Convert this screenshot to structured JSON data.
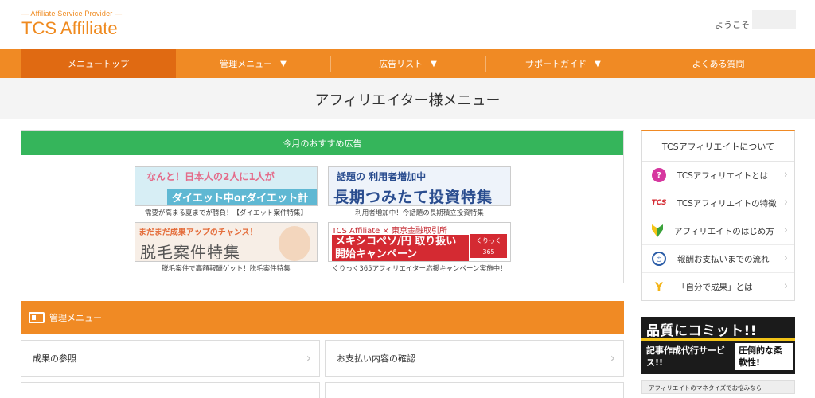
{
  "header": {
    "tagline": "— Affiliate Service Provider —",
    "brand": "TCS Affiliate",
    "welcome": "ようこそ"
  },
  "nav": {
    "items": [
      {
        "label": "メニュートップ",
        "caret": false
      },
      {
        "label": "管理メニュー",
        "caret": true
      },
      {
        "label": "広告リスト",
        "caret": true
      },
      {
        "label": "サポートガイド",
        "caret": true
      },
      {
        "label": "よくある質問",
        "caret": false
      }
    ],
    "caret_char": "▼"
  },
  "page": {
    "title": "アフィリエイター様メニュー"
  },
  "recommended": {
    "heading": "今月のおすすめ広告",
    "ads": [
      {
        "banner_line1": "なんと！日本人の2人に1人が",
        "banner_line2": "ダイエット中orダイエット計画中",
        "caption": "需要が高まる夏までが勝負！【ダイエット案件特集】"
      },
      {
        "banner_line1": "話題の 利用者増加中",
        "banner_line2": "長期つみたて投資特集",
        "caption": "利用者増加中！今話題の長期積立投資特集"
      },
      {
        "banner_line1": "まだまだ成果アップのチャンス！",
        "banner_line2": "脱毛案件特集",
        "caption": "脱毛案件で高額報酬ゲット！脱毛案件特集"
      },
      {
        "banner_line1": "TCS Affiliate × 東京金融取引所",
        "banner_line2": "メキシコペソ/円 取り扱い開始キャンペーン",
        "banner_logo": "くりっく365",
        "caption": "くりっく365アフィリエイター応援キャンペーン実施中！"
      }
    ]
  },
  "management": {
    "heading": "管理メニュー",
    "items": [
      {
        "label": "成果の参照"
      },
      {
        "label": "お支払い内容の確認"
      }
    ],
    "arrow": "›"
  },
  "sidebar": {
    "heading": "TCSアフィリエイトについて",
    "items": [
      {
        "label": "TCSアフィリエイトとは",
        "icon": "question-icon",
        "glyph": "?"
      },
      {
        "label": "TCSアフィリエイトの特徴",
        "icon": "tcs-logo-icon",
        "glyph": "TCS"
      },
      {
        "label": "アフィリエイトのはじめ方",
        "icon": "beginner-mark-icon",
        "glyph": ""
      },
      {
        "label": "報酬お支払いまでの流れ",
        "icon": "clock-icon",
        "glyph": "◷"
      },
      {
        "label": "「自分で成果」とは",
        "icon": "trophy-icon",
        "glyph": "Y"
      }
    ],
    "arrow": "›",
    "banner": {
      "line1": "品質にコミット!!",
      "line2": "記事作成代行サービス!!",
      "box": "圧倒的な柔軟性!"
    },
    "banner2_text": "アフィリエイトのマネタイズでお悩みなら"
  },
  "colors": {
    "accent": "#f08a24",
    "nav_active": "#e06a12",
    "recommend_green": "#35b55b"
  }
}
